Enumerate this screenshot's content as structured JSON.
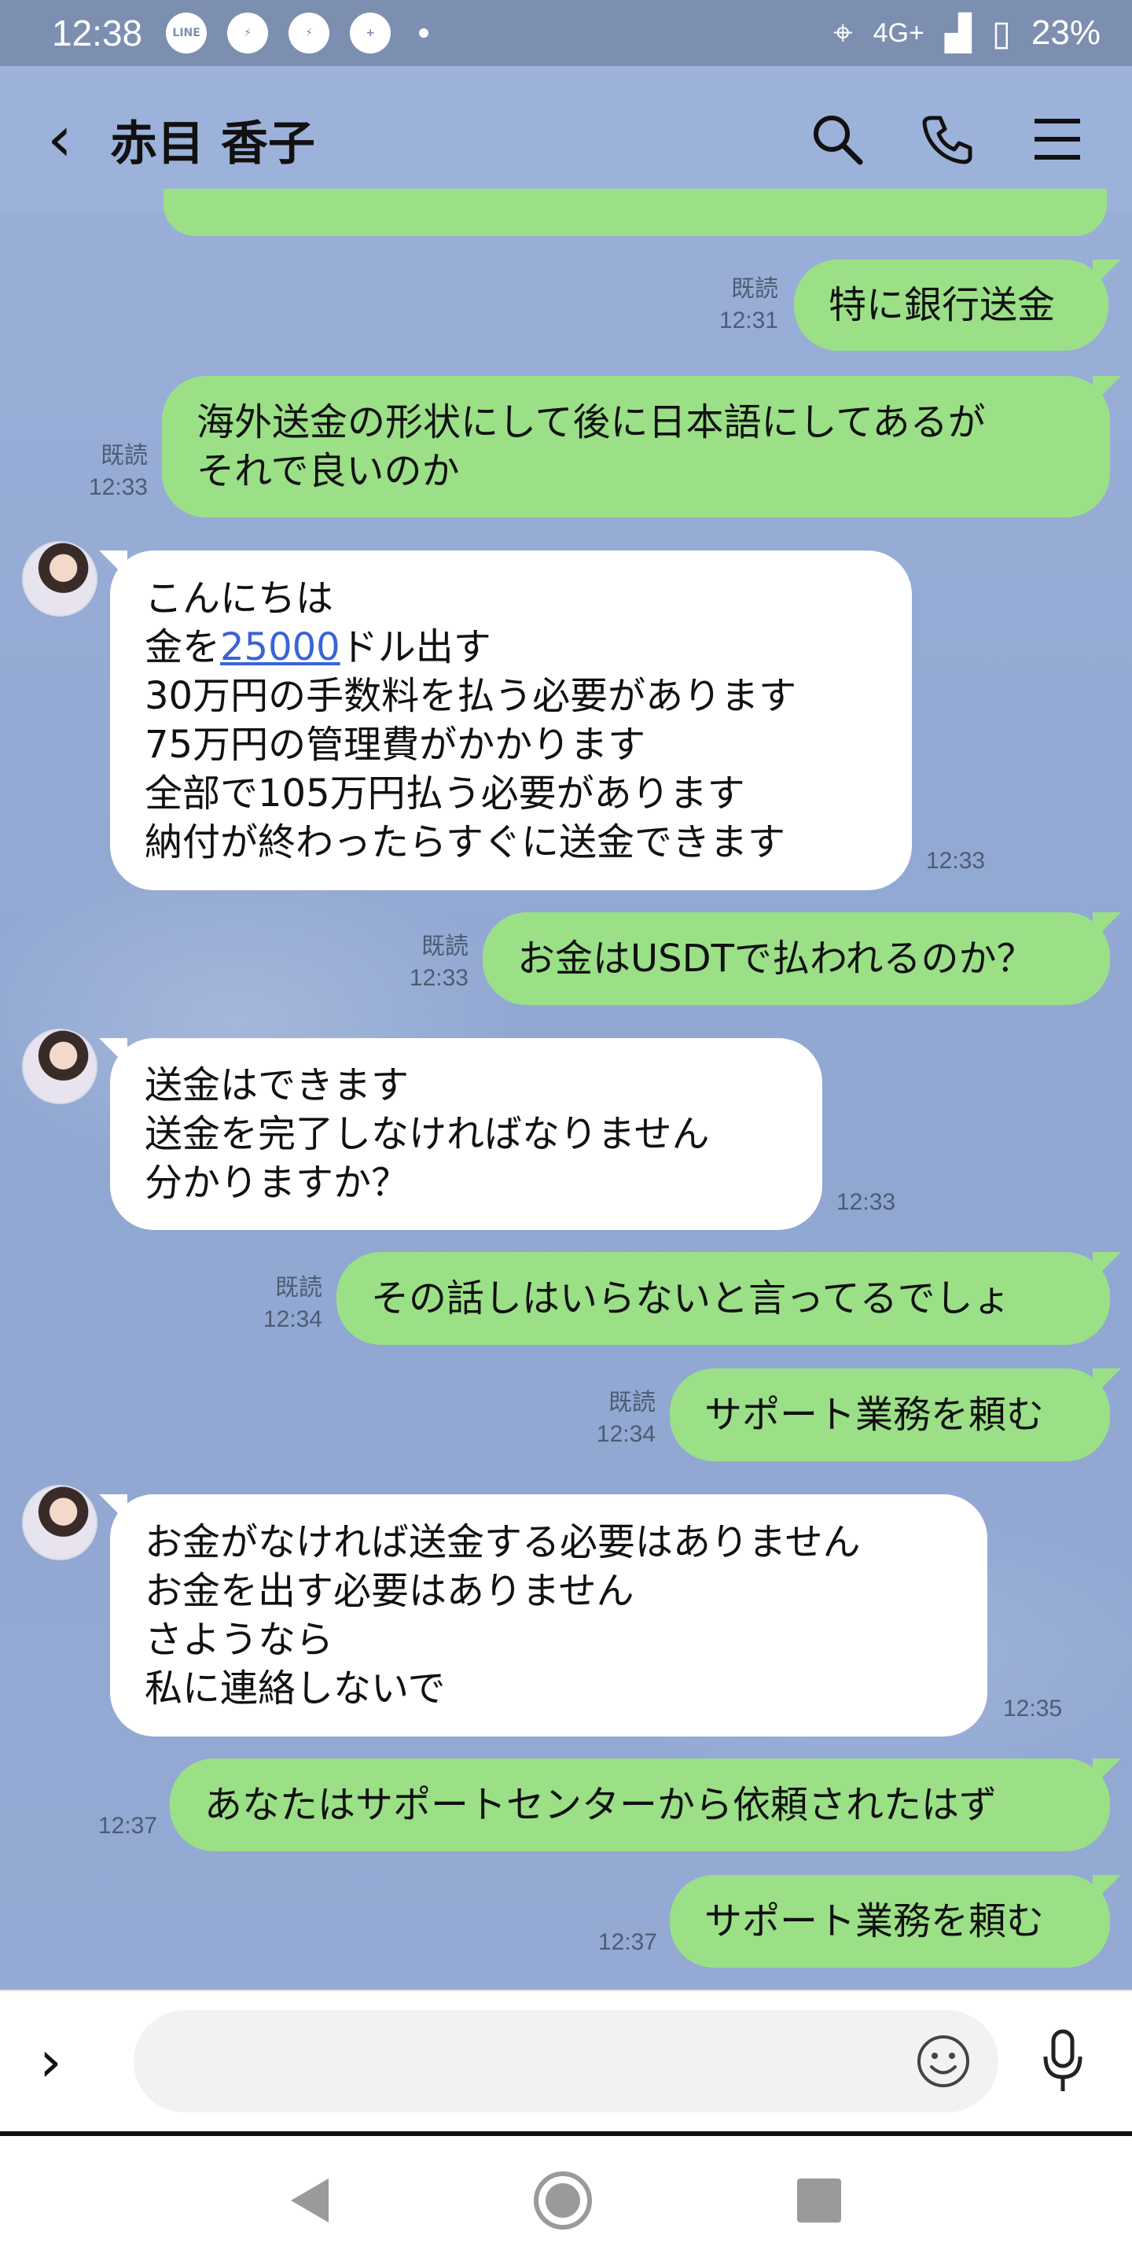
{
  "status_bar": {
    "time": "12:38",
    "network": "4G+",
    "battery": "23%",
    "notification_icons": [
      "line-icon",
      "messenger-icon",
      "messenger-icon",
      "chat-plus-icon"
    ]
  },
  "header": {
    "title": "赤目 香子",
    "back_icon": "chevron-left-icon",
    "actions": [
      "search-icon",
      "phone-icon",
      "menu-icon"
    ]
  },
  "messages": [
    {
      "dir": "out",
      "text": "特に銀行送金",
      "read": "既読",
      "time": "12:31"
    },
    {
      "dir": "out",
      "lines": [
        "海外送金の形状にして後に日本語にしてあるが",
        "それで良いのか"
      ],
      "read": "既読",
      "time": "12:33"
    },
    {
      "dir": "in",
      "lines": [
        "こんにちは",
        "金を",
        "25000",
        "ドル出す",
        "30万円の手数料を払う必要があります",
        "75万円の管理費がかかります",
        "全部で105万円払う必要があります",
        "納付が終わったらすぐに送金できます"
      ],
      "time": "12:33"
    },
    {
      "dir": "out",
      "text": "お金はUSDTで払われるのか？",
      "read": "既読",
      "time": "12:33"
    },
    {
      "dir": "in",
      "lines": [
        "送金はできます",
        "送金を完了しなければなりません",
        "分かりますか？"
      ],
      "time": "12:33"
    },
    {
      "dir": "out",
      "text": "その話しはいらないと言ってるでしょ",
      "read": "既読",
      "time": "12:34"
    },
    {
      "dir": "out",
      "text": "サポート業務を頼む",
      "read": "既読",
      "time": "12:34"
    },
    {
      "dir": "in",
      "lines": [
        "お金がなければ送金する必要はありません",
        "お金を出す必要はありません",
        "さようなら",
        "私に連絡しないで"
      ],
      "time": "12:35"
    },
    {
      "dir": "out",
      "text": "あなたはサポートセンターから依頼されたはず",
      "read": "",
      "time": "12:37"
    },
    {
      "dir": "out",
      "text": "サポート業務を頼む",
      "read": "",
      "time": "12:37"
    }
  ],
  "input": {
    "placeholder": "",
    "expand_icon": "chevron-right-icon",
    "emoji_icon": "smile-icon",
    "mic_icon": "mic-icon"
  },
  "colors": {
    "outgoing_bubble": "#9be087",
    "incoming_bubble": "#ffffff",
    "background": "#9bb0d8",
    "link": "#3b63d6"
  }
}
